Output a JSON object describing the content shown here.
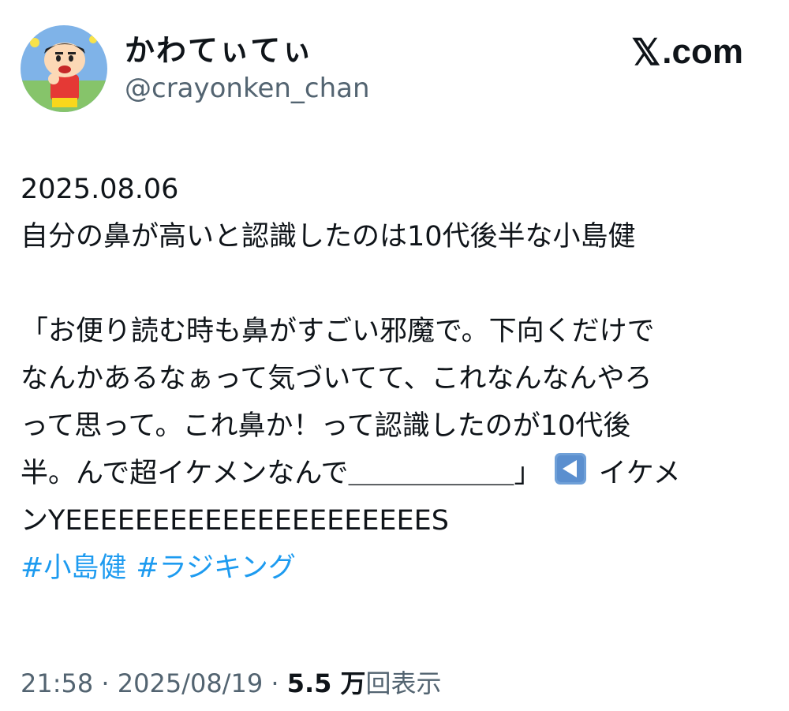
{
  "author": {
    "display_name": "かわてぃてぃ",
    "handle": "@crayonken_chan",
    "avatar_icon": "cartoon-avatar-icon"
  },
  "brand": {
    "x_mark": "𝕏",
    "domain": ".com"
  },
  "tweet": {
    "date_line": "2025.08.06",
    "line2": "自分の鼻が高いと認識したのは10代後半な小島健",
    "quote_lines": [
      "「お便り読む時も鼻がすごい邪魔で。下向くだけで",
      "なんかあるなぁって気づいてて、これなんなんやろ",
      "って思って。これ鼻か！って認識したのが10代後",
      "半。んで超イケメンなんで＿＿＿＿＿＿」"
    ],
    "arrow_emoji": "back-arrow-icon",
    "after_arrow": "イケメ",
    "last_line": "ンYEEEEEEEEEEEEEEEEEEEEES",
    "hashtags": [
      "#小島健",
      "#ラジキング"
    ]
  },
  "meta": {
    "time": "21:58",
    "sep1": " · ",
    "date": "2025/08/19",
    "sep2": " · ",
    "views_count": "5.5 万",
    "views_label": "回表示"
  },
  "colors": {
    "text": "#0f1419",
    "secondary": "#536471",
    "link": "#1d9bf0"
  }
}
